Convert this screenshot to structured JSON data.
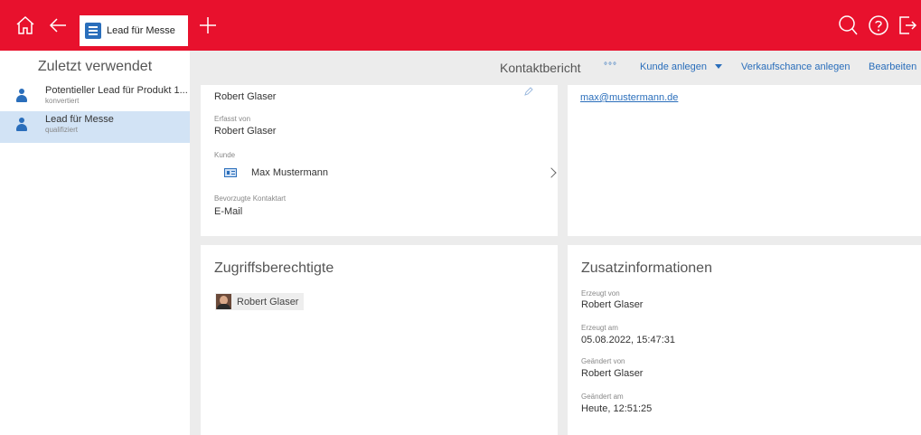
{
  "topbar": {
    "active_tab_label": "Lead für Messe",
    "colors": {
      "brand": "#e8112d",
      "link": "#2a6ebb"
    }
  },
  "sidebar": {
    "title": "Zuletzt verwendet",
    "items": [
      {
        "title": "Potentieller Lead für Produkt 1...",
        "status": "konvertiert"
      },
      {
        "title": "Lead für Messe",
        "status": "qualifiziert"
      }
    ]
  },
  "commandbar": {
    "title": "Kontaktbericht",
    "more_label": "°°°",
    "create_customer_label": "Kunde anlegen",
    "create_opportunity_label": "Verkaufschance anlegen",
    "edit_label": "Bearbeiten"
  },
  "details": {
    "top_value": "Robert Glaser",
    "erfasst_von_label": "Erfasst von",
    "erfasst_von_value": "Robert Glaser",
    "kunde_label": "Kunde",
    "kunde_value": "Max Mustermann",
    "kontaktart_label": "Bevorzugte Kontaktart",
    "kontaktart_value": "E-Mail"
  },
  "contact": {
    "email": "max@mustermann.de"
  },
  "access": {
    "title": "Zugriffsberechtigte",
    "users": [
      "Robert Glaser"
    ]
  },
  "additional": {
    "title": "Zusatzinformationen",
    "erzeugt_von_label": "Erzeugt von",
    "erzeugt_von_value": "Robert Glaser",
    "erzeugt_am_label": "Erzeugt am",
    "erzeugt_am_value": "05.08.2022, 15:47:31",
    "geaendert_von_label": "Geändert von",
    "geaendert_von_value": "Robert Glaser",
    "geaendert_am_label": "Geändert am",
    "geaendert_am_value": "Heute, 12:51:25"
  }
}
